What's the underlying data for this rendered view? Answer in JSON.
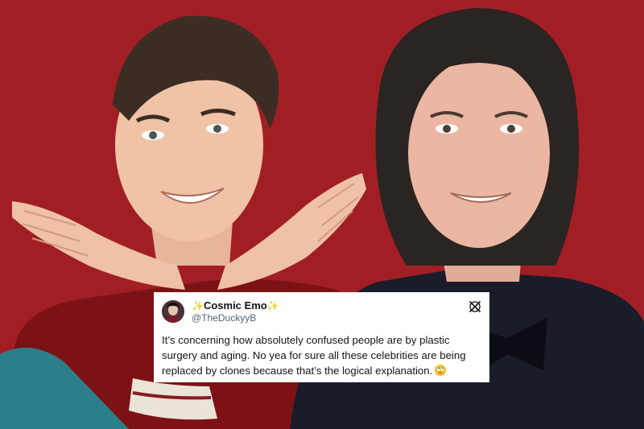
{
  "tweet": {
    "display_name": "Cosmic Emo",
    "handle": "@TheDuckyyB",
    "text": "It’s concerning how absolutely confused people are by plastic surgery and aging. No yea for sure all these celebrities are being replaced by clones because that’s the logical explanation."
  },
  "icons": {
    "sparkle": "sparkles-emoji",
    "platform": "x-logo-icon",
    "emoji": "face-with-rolling-eyes-emoji"
  },
  "colors": {
    "background": "#a11f24",
    "card": "#ffffff",
    "text": "#0f1419",
    "handle": "#536471",
    "sparkle": "#f3b51b"
  }
}
